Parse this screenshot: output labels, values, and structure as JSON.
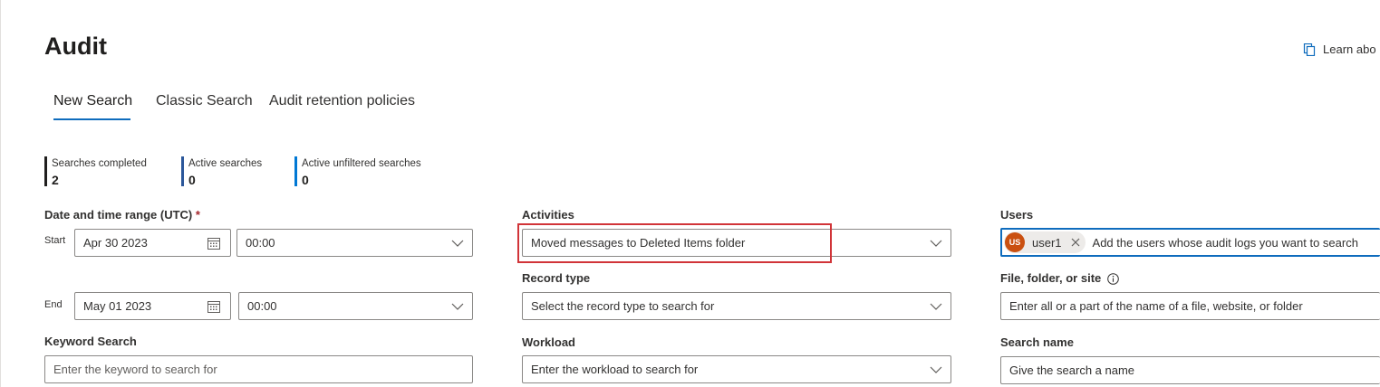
{
  "page": {
    "title": "Audit",
    "learn_link": "Learn abo"
  },
  "tabs": [
    {
      "label": "New Search",
      "active": true
    },
    {
      "label": "Classic Search",
      "active": false
    },
    {
      "label": "Audit retention policies",
      "active": false
    }
  ],
  "metrics": [
    {
      "label": "Searches completed",
      "value": "2",
      "color": "#201f1e"
    },
    {
      "label": "Active searches",
      "value": "0",
      "color": "#2b579a"
    },
    {
      "label": "Active unfiltered searches",
      "value": "0",
      "color": "#0078d4"
    }
  ],
  "date_range": {
    "label": "Date and time range (UTC)",
    "required_mark": "*",
    "start": {
      "label": "Start",
      "date": "Apr 30 2023",
      "time": "00:00"
    },
    "end": {
      "label": "End",
      "date": "May 01 2023",
      "time": "00:00"
    }
  },
  "keyword": {
    "label": "Keyword Search",
    "placeholder": "Enter the keyword to search for"
  },
  "activities": {
    "label": "Activities",
    "value": "Moved messages to Deleted Items folder"
  },
  "record_type": {
    "label": "Record type",
    "placeholder": "Select the record type to search for"
  },
  "workload": {
    "label": "Workload",
    "placeholder": "Enter the workload to search for"
  },
  "users": {
    "label": "Users",
    "selected": [
      {
        "initials": "US",
        "name": "user1"
      }
    ],
    "placeholder": "Add the users whose audit logs you want to search"
  },
  "file_folder": {
    "label": "File, folder, or site",
    "placeholder": "Enter all or a part of the name of a file, website, or folder"
  },
  "search_name": {
    "label": "Search name",
    "placeholder": "Give the search a name"
  },
  "colors": {
    "accent": "#0f6cbd",
    "highlight": "#d13438",
    "avatar": "#ca5010"
  }
}
